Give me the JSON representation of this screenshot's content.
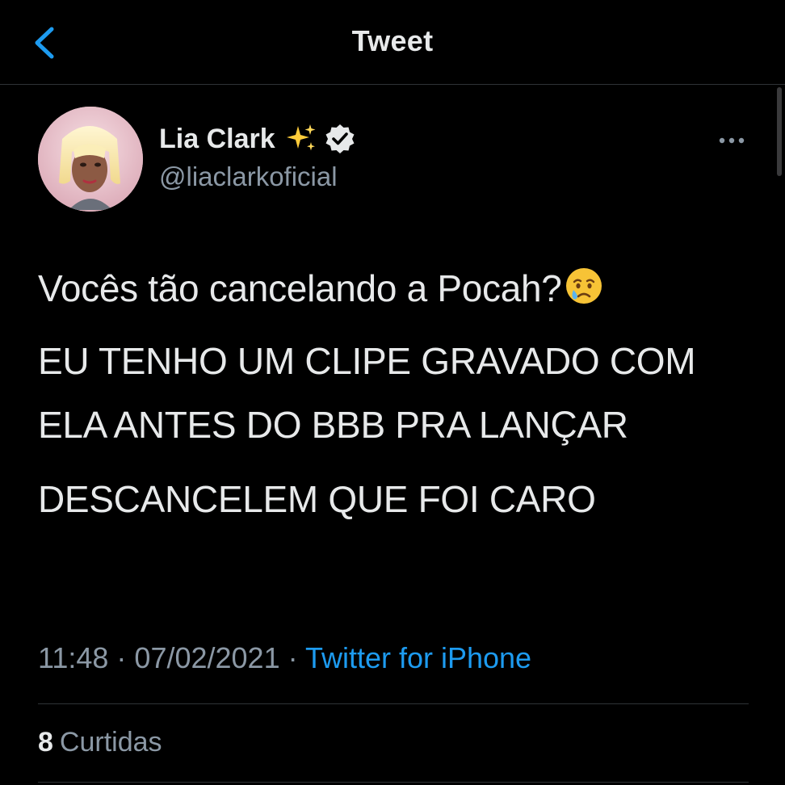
{
  "nav": {
    "title": "Tweet",
    "back_icon": "chevron-left-icon"
  },
  "author": {
    "display_name": "Lia Clark",
    "name_emoji": "sparkles-icon",
    "verified_icon": "verified-badge-icon",
    "handle": "@liaclarkoficial"
  },
  "tweet": {
    "line1_text": "Vocês tão cancelando a Pocah?",
    "line1_emoji": "crying-face-icon",
    "paragraph2": "EU TENHO UM CLIPE GRAVADO COM ELA ANTES DO BBB PRA LANÇAR",
    "paragraph3": "DESCANCELEM QUE FOI CARO"
  },
  "meta": {
    "time": "11:48",
    "separator": " · ",
    "date": "07/02/2021",
    "source": "Twitter for iPhone"
  },
  "stats": {
    "likes_count": "8",
    "likes_label": "Curtidas"
  },
  "colors": {
    "background": "#000000",
    "text_primary": "#e7e9ea",
    "text_secondary": "#8b98a5",
    "accent": "#1d9bf0",
    "divider": "#2f3336"
  }
}
